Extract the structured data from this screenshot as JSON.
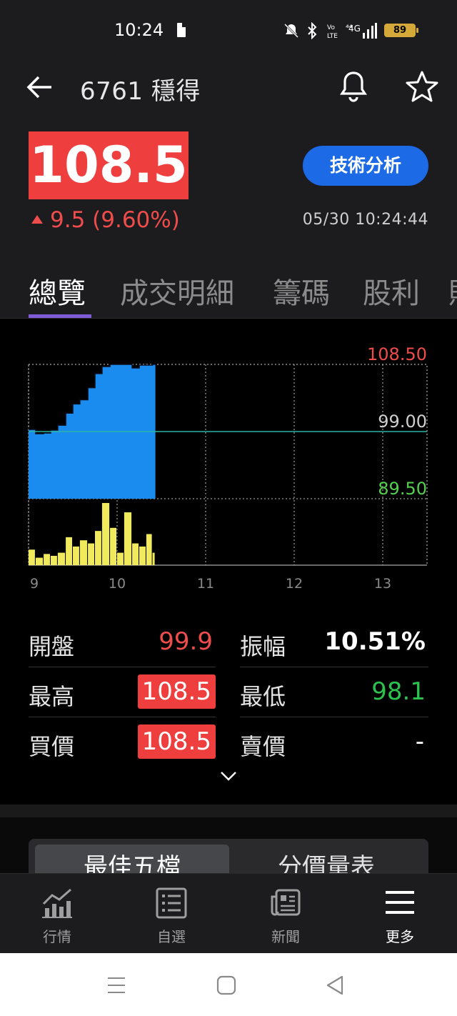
{
  "status_bar": {
    "time": "10:24",
    "battery": "89",
    "icons": [
      "note-icon",
      "mute-icon",
      "bluetooth-icon",
      "volte-icon",
      "4g-icon",
      "signal-icon",
      "battery-icon"
    ]
  },
  "header": {
    "title": "6761 穩得",
    "back_icon": "arrow-left-icon",
    "bell_icon": "bell-icon",
    "star_icon": "star-icon"
  },
  "quote": {
    "price": "108.5",
    "change": "9.5 (9.60%)",
    "datetime": "05/30 10:24:44",
    "tech_button": "技術分析",
    "up_color": "#ef3e3e",
    "accent": "#1c6ae6"
  },
  "tabs": [
    {
      "label": "總覽",
      "active": true
    },
    {
      "label": "成交明細",
      "active": false
    },
    {
      "label": "籌碼",
      "active": false
    },
    {
      "label": "股利",
      "active": false
    }
  ],
  "chart_data": {
    "type": "area",
    "y_labels": [
      "108.50",
      "99.00",
      "89.50"
    ],
    "y_label_colors": [
      "#ef4c4c",
      "#cfcfcf",
      "#55d04e"
    ],
    "ylim": [
      89.5,
      108.5
    ],
    "reference": 99.0,
    "x_ticks": [
      "9",
      "10",
      "11",
      "12",
      "13"
    ],
    "xlim": [
      9,
      13.5
    ],
    "price_series": {
      "x": [
        9.0,
        9.08,
        9.17,
        9.25,
        9.33,
        9.42,
        9.5,
        9.58,
        9.67,
        9.75,
        9.83,
        9.92,
        10.0,
        10.08,
        10.17,
        10.25,
        10.33,
        10.4
      ],
      "y": [
        99.3,
        98.7,
        98.8,
        99.2,
        99.9,
        101.6,
        102.9,
        103.5,
        105.2,
        107.2,
        108.2,
        108.5,
        108.5,
        108.5,
        108.0,
        108.4,
        108.4,
        108.5
      ]
    },
    "volume_series": {
      "x": [
        9.0,
        9.08,
        9.17,
        9.25,
        9.33,
        9.42,
        9.5,
        9.58,
        9.67,
        9.75,
        9.83,
        9.92,
        10.0,
        10.08,
        10.17,
        10.25,
        10.33,
        10.4
      ],
      "y": [
        25,
        12,
        18,
        15,
        20,
        45,
        30,
        40,
        35,
        55,
        100,
        60,
        20,
        85,
        35,
        30,
        50,
        20
      ]
    }
  },
  "stats": {
    "open_label": "開盤",
    "open": "99.9",
    "amp_label": "振幅",
    "amp": "10.51%",
    "high_label": "最高",
    "high": "108.5",
    "low_label": "最低",
    "low": "98.1",
    "bid_label": "買價",
    "bid": "108.5",
    "ask_label": "賣價",
    "ask": "-"
  },
  "segment": {
    "left": "最佳五檔",
    "right": "分價量表"
  },
  "nav": [
    {
      "label": "行情",
      "icon": "chart-icon",
      "active": false
    },
    {
      "label": "自選",
      "icon": "list-icon",
      "active": false
    },
    {
      "label": "新聞",
      "icon": "news-icon",
      "active": false
    },
    {
      "label": "更多",
      "icon": "menu-icon",
      "active": true
    }
  ]
}
